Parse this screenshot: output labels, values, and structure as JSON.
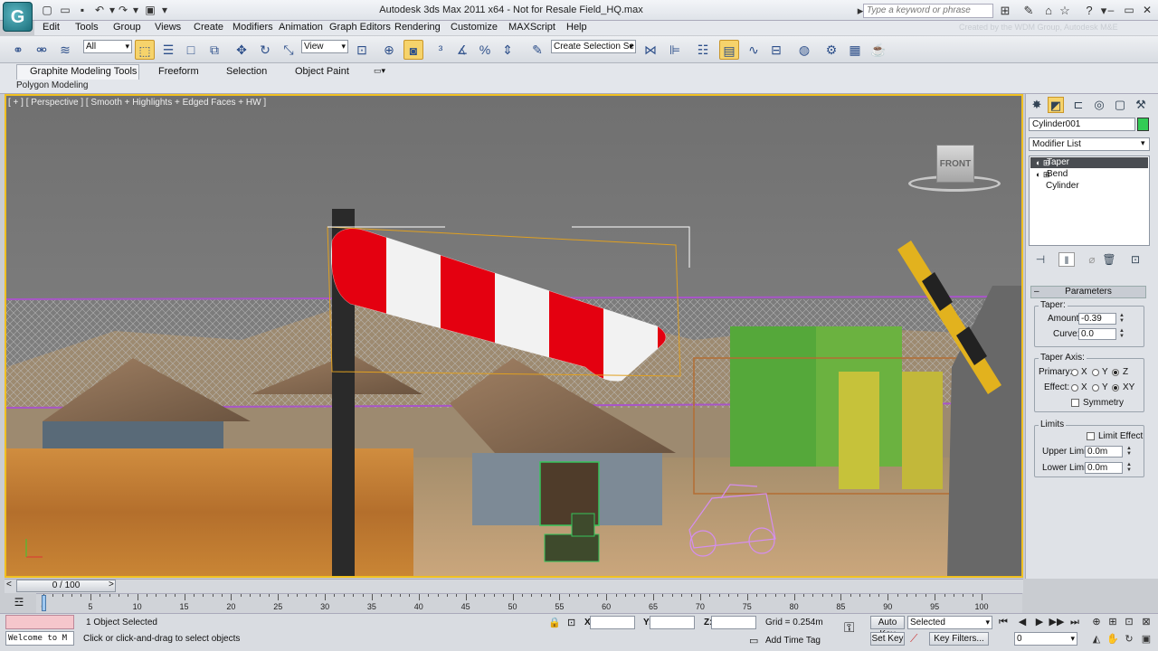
{
  "titlebar": {
    "title": "Autodesk 3ds Max  2011 x64   -  Not for Resale   Field_HQ.max",
    "search_placeholder": "Type a keyword or phrase",
    "app_logo": "G"
  },
  "menu": [
    "Edit",
    "Tools",
    "Group",
    "Views",
    "Create",
    "Modifiers",
    "Animation",
    "Graph Editors",
    "Rendering",
    "Customize",
    "MAXScript",
    "Help"
  ],
  "credit": "Created by the WDM Group, Autodesk M&E",
  "toolbar": {
    "selection_filter": "All",
    "ref_coord": "View",
    "named_selection_placeholder": "Create Selection Se"
  },
  "ribbon": {
    "tabs": [
      "Graphite Modeling Tools",
      "Freeform",
      "Selection",
      "Object Paint"
    ],
    "sub_label": "Polygon Modeling"
  },
  "viewport": {
    "label": "[ + ] [ Perspective ] [ Smooth + Highlights + Edged Faces + HW ]",
    "viewcube_face": "FRONT"
  },
  "command_panel": {
    "object_name": "Cylinder001",
    "object_color": "#33cc55",
    "modifier_list": "Modifier List",
    "stack": [
      "Taper",
      "Bend",
      "Cylinder"
    ],
    "rollout_title": "Parameters",
    "taper": {
      "group": "Taper:",
      "amount_label": "Amount:",
      "amount": "-0.39",
      "curve_label": "Curve:",
      "curve": "0.0"
    },
    "taper_axis": {
      "group": "Taper Axis:",
      "primary_label": "Primary:",
      "effect_label": "Effect:",
      "primary_options": [
        "X",
        "Y",
        "Z"
      ],
      "effect_options": [
        "X",
        "Y",
        "XY"
      ],
      "symmetry_label": "Symmetry"
    },
    "limits": {
      "group": "Limits",
      "limit_effect_label": "Limit Effect",
      "upper_label": "Upper Limit:",
      "upper": "0.0m",
      "lower_label": "Lower Limit:",
      "lower": "0.0m"
    }
  },
  "timeline": {
    "slider_label": "0 / 100",
    "ticks": [
      "0",
      "5",
      "10",
      "15",
      "20",
      "25",
      "30",
      "35",
      "40",
      "45",
      "50",
      "55",
      "60",
      "65",
      "70",
      "75",
      "80",
      "85",
      "90",
      "95",
      "100"
    ]
  },
  "status": {
    "listener_text": "Welcome to M",
    "selection": "1 Object Selected",
    "prompt": "Click or click-and-drag to select objects",
    "x_label": "X:",
    "y_label": "Y:",
    "z_label": "Z:",
    "grid": "Grid = 0.254m",
    "add_time_tag": "Add Time Tag",
    "auto_key": "Auto Key",
    "set_key": "Set Key",
    "key_mode": "Selected",
    "key_filters": "Key Filters...",
    "current_frame": "0"
  }
}
